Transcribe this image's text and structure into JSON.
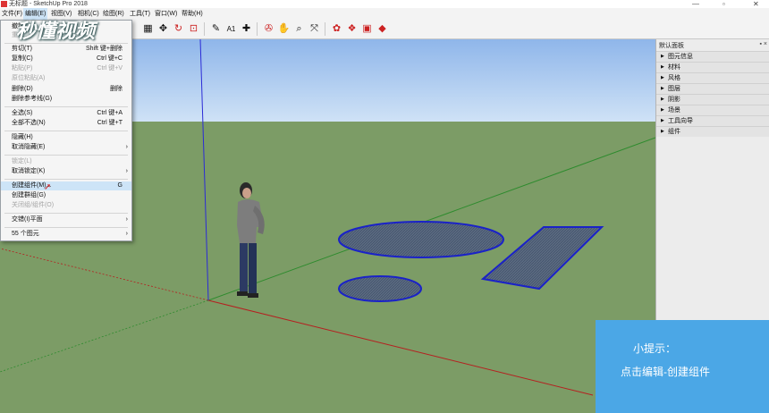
{
  "window": {
    "title": "无标题 - SketchUp Pro 2018",
    "minimize": "—",
    "restore": "▫",
    "close": "✕"
  },
  "watermark": "秒懂视频",
  "menubar": [
    "文件(F)",
    "编辑(E)",
    "视图(V)",
    "相机(C)",
    "绘图(R)",
    "工具(T)",
    "窗口(W)",
    "帮助(H)"
  ],
  "edit_menu": {
    "items": [
      {
        "label": "撤销",
        "shortcut": "",
        "submenu": false,
        "disabled": false
      },
      {
        "label": "重复",
        "shortcut": "",
        "submenu": false,
        "disabled": true
      },
      {
        "label": "剪切(T)",
        "shortcut": "Shift 键+删除",
        "submenu": false,
        "disabled": false
      },
      {
        "label": "复制(C)",
        "shortcut": "Ctrl 键+C",
        "submenu": false,
        "disabled": false
      },
      {
        "label": "粘贴(P)",
        "shortcut": "Ctrl 键+V",
        "submenu": false,
        "disabled": true
      },
      {
        "label": "原位粘贴(A)",
        "shortcut": "",
        "submenu": false,
        "disabled": true
      },
      {
        "label": "删除(D)",
        "shortcut": "删除",
        "submenu": false,
        "disabled": false
      },
      {
        "label": "删除参考线(G)",
        "shortcut": "",
        "submenu": false,
        "disabled": false
      },
      {
        "label": "全选(S)",
        "shortcut": "Ctrl 键+A",
        "submenu": false,
        "disabled": false
      },
      {
        "label": "全部不选(N)",
        "shortcut": "Ctrl 键+T",
        "submenu": false,
        "disabled": false
      },
      {
        "label": "隐藏(H)",
        "shortcut": "",
        "submenu": false,
        "disabled": false
      },
      {
        "label": "取消隐藏(E)",
        "shortcut": "",
        "submenu": true,
        "disabled": false
      },
      {
        "label": "锁定(L)",
        "shortcut": "",
        "submenu": false,
        "disabled": true
      },
      {
        "label": "取消锁定(K)",
        "shortcut": "",
        "submenu": true,
        "disabled": false
      },
      {
        "label": "创建组件(M)...",
        "shortcut": "G",
        "submenu": false,
        "disabled": false
      },
      {
        "label": "创建群组(G)",
        "shortcut": "",
        "submenu": false,
        "disabled": false
      },
      {
        "label": "关闭组/组件(O)",
        "shortcut": "",
        "submenu": false,
        "disabled": true
      },
      {
        "label": "交错(I)平面",
        "shortcut": "",
        "submenu": true,
        "disabled": false
      },
      {
        "label": "55 个图元",
        "shortcut": "",
        "submenu": true,
        "disabled": false
      }
    ]
  },
  "toolbar_icons": [
    "select-icon",
    "eraser-icon",
    "paint-bucket-icon",
    "line-icon",
    "rectangle-icon",
    "circle-icon",
    "push-pull-icon",
    "move-icon",
    "rotate-icon",
    "scale-icon",
    "tape-measure-icon",
    "text-icon",
    "axes-icon",
    "section-plane-icon",
    "orbit-icon",
    "pan-icon",
    "zoom-icon",
    "zoom-extents-icon",
    "warehouse-icon",
    "extension-warehouse-icon",
    "layout-icon",
    "ruby-icon"
  ],
  "panel": {
    "title": "默认面板",
    "pin": "▪ ×",
    "items": [
      "图元信息",
      "材料",
      "风格",
      "图层",
      "阴影",
      "场景",
      "工具向导",
      "组件"
    ]
  },
  "tip": {
    "title": "小提示：",
    "body": "点击编辑-创建组件"
  },
  "colors": {
    "sky": "#a6c7f0",
    "ground": "#7a9a64",
    "selection_blue": "#1a22c8",
    "tip_bg": "#4ba7e6"
  }
}
